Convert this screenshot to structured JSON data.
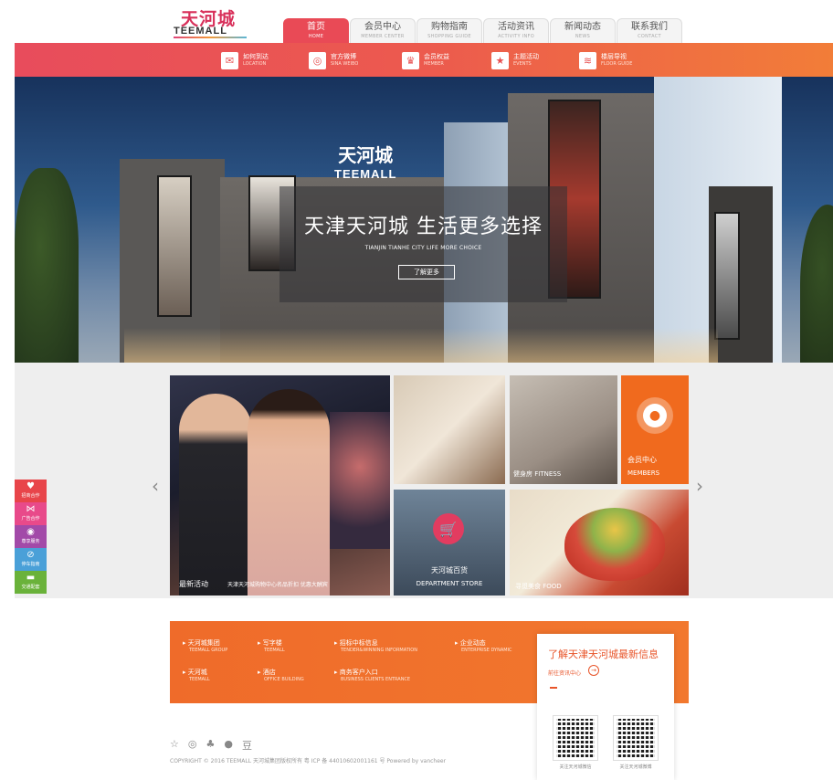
{
  "header": {
    "logo_cn": "天河城",
    "logo_en": "TEEMALL",
    "tabs": [
      {
        "cn": "首页",
        "en": "HOME"
      },
      {
        "cn": "会员中心",
        "en": "MEMBER CENTER"
      },
      {
        "cn": "购物指南",
        "en": "SHOPPING GUIDE"
      },
      {
        "cn": "活动资讯",
        "en": "ACTIVITY INFO"
      },
      {
        "cn": "新闻动态",
        "en": "NEWS"
      },
      {
        "cn": "联系我们",
        "en": "CONTACT"
      }
    ],
    "active_color": "#e94a56"
  },
  "subnav": [
    {
      "cn": "如何到达",
      "en": "LOCATION",
      "icon": "chat-bubble-icon"
    },
    {
      "cn": "官方微博",
      "en": "SINA WEIBO",
      "icon": "weibo-icon"
    },
    {
      "cn": "会员权益",
      "en": "MEMBER",
      "icon": "crown-icon"
    },
    {
      "cn": "主题活动",
      "en": "EVENTS",
      "icon": "star-icon"
    },
    {
      "cn": "楼层导视",
      "en": "FLOOR GUIDE",
      "icon": "layers-icon"
    }
  ],
  "hero": {
    "building_logo_cn": "天河城",
    "building_logo_en": "TEEMALL",
    "title": "天津天河城 生活更多选择",
    "subtitle": "TIANJIN TIANHE CITY LIFE MORE CHOICE",
    "button": "了解更多"
  },
  "grid": {
    "prev": "‹",
    "next": "›",
    "event_label": "最新活动",
    "event_desc": "天津天河城购物中心名品折扣 优惠大酬宾",
    "fitness": "健身房 FITNESS",
    "members_cn": "会员中心",
    "members_en": "MEMBERS",
    "dept_cn": "天河城百货",
    "dept_en": "DEPARTMENT STORE",
    "food": "寻觅美食 FOOD"
  },
  "side": [
    {
      "label": "招商合作",
      "color": "#e8454a",
      "icon": "heart-hand-icon"
    },
    {
      "label": "广告合作",
      "color": "#e84a8a",
      "icon": "ribbon-icon"
    },
    {
      "label": "尊享服务",
      "color": "#a24aa8",
      "icon": "user-circle-icon"
    },
    {
      "label": "停车指南",
      "color": "#4aa0d8",
      "icon": "compass-icon"
    },
    {
      "label": "交通配套",
      "color": "#6ab23a",
      "icon": "car-icon"
    }
  ],
  "footer_links": [
    {
      "cn": "天河城集团",
      "en": "TEEMALL GROUP"
    },
    {
      "cn": "写字楼",
      "en": "TEEMALL"
    },
    {
      "cn": "招标中标信息",
      "en": "TENDER&WINNING INFORMATION"
    },
    {
      "cn": "企业动态",
      "en": "ENTERPRISE DYNAMIC"
    },
    {
      "cn": "天河城",
      "en": "TEEMALL"
    },
    {
      "cn": "酒店",
      "en": "OFFICE BUILDING"
    },
    {
      "cn": "商务客户入口",
      "en": "BUSINESS CLIENTS ENTRANCE"
    }
  ],
  "info": {
    "title": "了解天津天河城最新信息",
    "link": "前往资讯中心",
    "qr1_caption": "关注天河城微信",
    "qr2_caption": "关注天河城微博"
  },
  "social_icons": [
    "star-icon",
    "weibo-icon",
    "penguin-icon",
    "wechat-icon",
    "douban-icon"
  ],
  "social_glyphs": [
    "☆",
    "◎",
    "♣",
    "●",
    "豆"
  ],
  "copyright": "COPYRIGHT © 2016 TEEMALL 天河城集团版权所有 粤 ICP 备 44010602001161 号 Powered by vancheer"
}
